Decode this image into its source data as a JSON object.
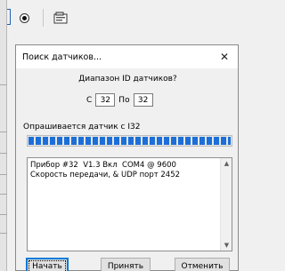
{
  "background": {
    "toolbar": {
      "icons": [
        "selection-edge-icon",
        "radio-icon",
        "document-icon"
      ]
    }
  },
  "dialog": {
    "title": "Поиск датчиков...",
    "close_glyph": "✕",
    "range_heading": "Диапазон ID датчиков?",
    "from_label": "С",
    "from_value": "32",
    "to_label": "По",
    "to_value": "32",
    "status": "Опрашивается датчик с I32",
    "progress_percent": 100,
    "log_text": "Прибор #32  V1.3 Вкл  COM4 @ 9600 Скорость передачи, & UDP порт 2452",
    "buttons": {
      "start": "Начать",
      "accept": "Принять",
      "cancel": "Отменить"
    }
  },
  "colors": {
    "progress": "#1c6fd8",
    "focus": "#0078d7"
  }
}
